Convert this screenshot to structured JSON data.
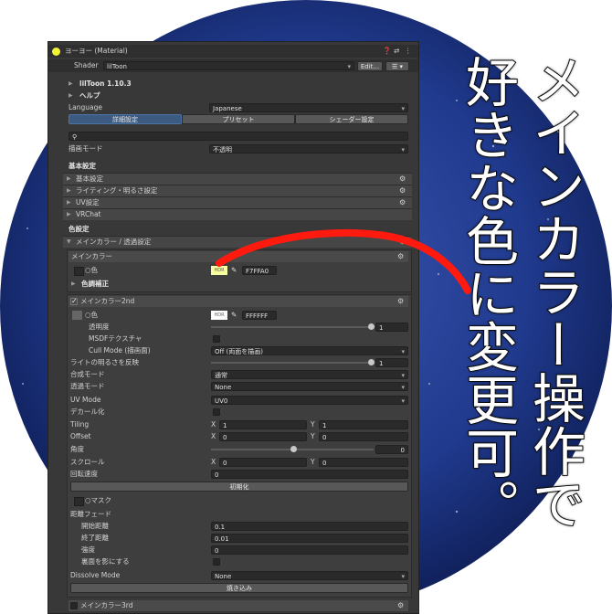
{
  "colors": {
    "accent": "#3d5a80",
    "arrow": "#ff1a10",
    "circle": "#1a2a70",
    "panel": "#383838",
    "hdr_badge": "#f2f236"
  },
  "window": {
    "title": "ヨーヨー (Material)",
    "shader_label": "Shader",
    "shader_value": "lilToon",
    "edit_label": "Edit..."
  },
  "header": {
    "version": "lilToon 1.10.3",
    "help": "ヘルプ",
    "language_label": "Language",
    "language_value": "Japanese"
  },
  "tabs": [
    "詳細設定",
    "プリセット",
    "シェーダー設定"
  ],
  "search_placeholder": "",
  "render_mode": {
    "label": "描画モード",
    "value": "不透明"
  },
  "basic": {
    "title": "基本設定",
    "items": [
      "基本設定",
      "ライティング・明るさ設定",
      "UV設定",
      "VRChat"
    ]
  },
  "color_section": {
    "title": "色設定",
    "group": "メインカラー / 透過設定"
  },
  "main_color": {
    "title": "メインカラー",
    "color_label": "色",
    "hdr": "HDR",
    "hex": "F7FFA0",
    "adjust": "色調補正"
  },
  "main_color2": {
    "title": "メインカラー2nd",
    "color_label": "色",
    "hdr": "HDR",
    "hex": "FFFFFF",
    "rows": [
      {
        "label": "透明度",
        "value": "1"
      },
      {
        "label": "MSDFテクスチャ"
      },
      {
        "label": "Cull Mode (描画面)",
        "value": "Off (両面を描画)"
      },
      {
        "label": "ライトの明るさを反映",
        "value": "1"
      },
      {
        "label": "合成モード",
        "value": "通常"
      },
      {
        "label": "透過モード",
        "value": "None"
      },
      {
        "label": "UV Mode",
        "value": "UV0"
      },
      {
        "label": "デカール化"
      },
      {
        "label": "Tiling",
        "x": "1",
        "y": "1"
      },
      {
        "label": "Offset",
        "x": "0",
        "y": "0"
      },
      {
        "label": "角度",
        "value": "0"
      },
      {
        "label": "スクロール",
        "x": "0",
        "y": "0"
      },
      {
        "label": "回転速度",
        "value": "0"
      }
    ],
    "reset": "初期化",
    "mask": "マスク",
    "distance_fade": "距離フェード",
    "fade_rows": [
      {
        "label": "開始距離",
        "value": "0.1"
      },
      {
        "label": "終了距離",
        "value": "0.01"
      },
      {
        "label": "強度",
        "value": "0"
      },
      {
        "label": "裏面を影にする"
      }
    ],
    "dissolve_label": "Dissolve Mode",
    "dissolve_value": "None",
    "bake": "焼き込み",
    "next_title": "メインカラー3rd"
  },
  "xy": {
    "x": "X",
    "y": "Y"
  },
  "caption": [
    "メインカラー操作で",
    "好きな色に変更可。"
  ]
}
